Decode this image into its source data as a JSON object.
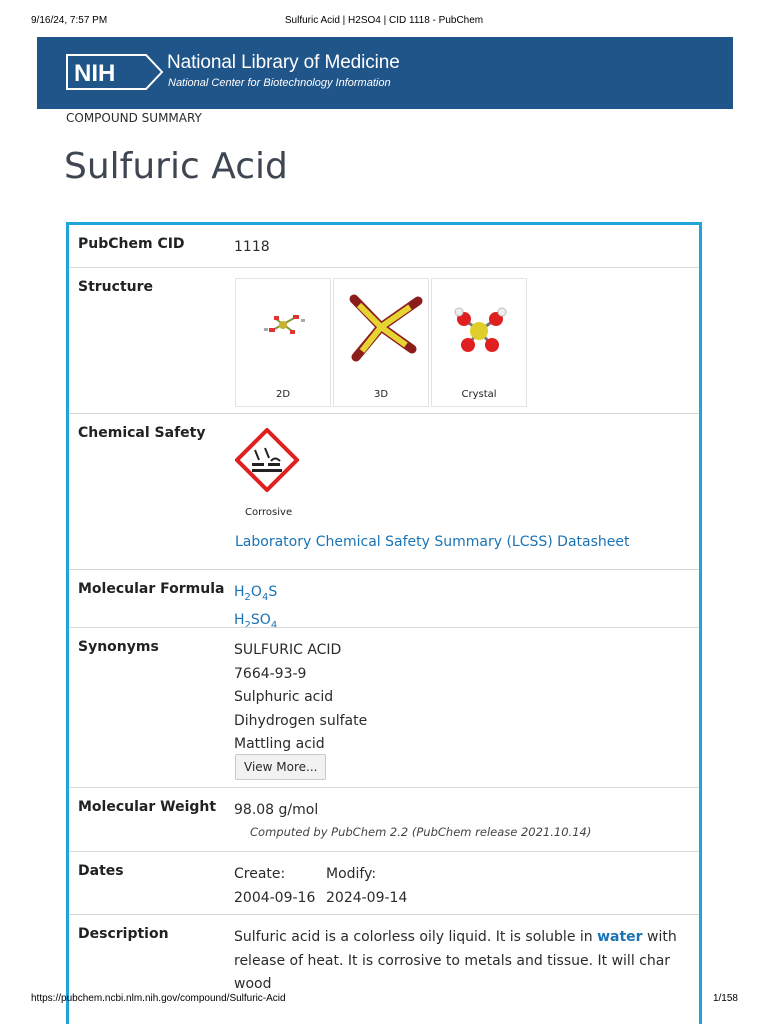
{
  "print_header": {
    "datetime": "9/16/24, 7:57 PM",
    "doc_title": "Sulfuric Acid | H2SO4 | CID 1118 - PubChem"
  },
  "banner": {
    "logo_text": "NIH",
    "title": "National Library of Medicine",
    "subtitle": "National Center for Biotechnology Information",
    "background_color": "#20558a"
  },
  "summary_label": "COMPOUND SUMMARY",
  "page_title": "Sulfuric Acid",
  "table": {
    "border_color": "#1fa3d9",
    "pubchem_cid": {
      "label": "PubChem CID",
      "value": "1118"
    },
    "structure": {
      "label": "Structure",
      "tiles": [
        {
          "caption": "2D",
          "icon": "2d-structure-icon"
        },
        {
          "caption": "3D",
          "icon": "3d-structure-icon"
        },
        {
          "caption": "Crystal",
          "icon": "crystal-structure-icon"
        }
      ]
    },
    "chemical_safety": {
      "label": "Chemical Safety",
      "pictogram_caption": "Corrosive",
      "pictogram_icon": "ghs-corrosive-icon",
      "link_text": "Laboratory Chemical Safety Summary (LCSS) Datasheet"
    },
    "molecular_formula": {
      "label": "Molecular Formula",
      "formulas": [
        [
          {
            "t": "H",
            "sub": false
          },
          {
            "t": "2",
            "sub": true
          },
          {
            "t": "O",
            "sub": false
          },
          {
            "t": "4",
            "sub": true
          },
          {
            "t": "S",
            "sub": false
          }
        ],
        [
          {
            "t": "H",
            "sub": false
          },
          {
            "t": "2",
            "sub": true
          },
          {
            "t": "SO",
            "sub": false
          },
          {
            "t": "4",
            "sub": true
          }
        ]
      ]
    },
    "synonyms": {
      "label": "Synonyms",
      "items": [
        "SULFURIC ACID",
        "7664-93-9",
        "Sulphuric acid",
        "Dihydrogen sulfate",
        "Mattling acid"
      ],
      "view_more": "View More..."
    },
    "molecular_weight": {
      "label": "Molecular Weight",
      "value": "98.08 g/mol",
      "note": "Computed by PubChem 2.2 (PubChem release 2021.10.14)"
    },
    "dates": {
      "label": "Dates",
      "create_label": "Create:",
      "create_value": "2004-09-16",
      "modify_label": "Modify:",
      "modify_value": "2024-09-14"
    },
    "description": {
      "label": "Description",
      "text_before": "Sulfuric acid is a colorless oily liquid. It is soluble in ",
      "link": "water",
      "text_after": " with release of heat. It is corrosive to metals and tissue. It will char wood"
    }
  },
  "print_footer": {
    "url": "https://pubchem.ncbi.nlm.nih.gov/compound/Sulfuric-Acid",
    "page": "1/158"
  }
}
